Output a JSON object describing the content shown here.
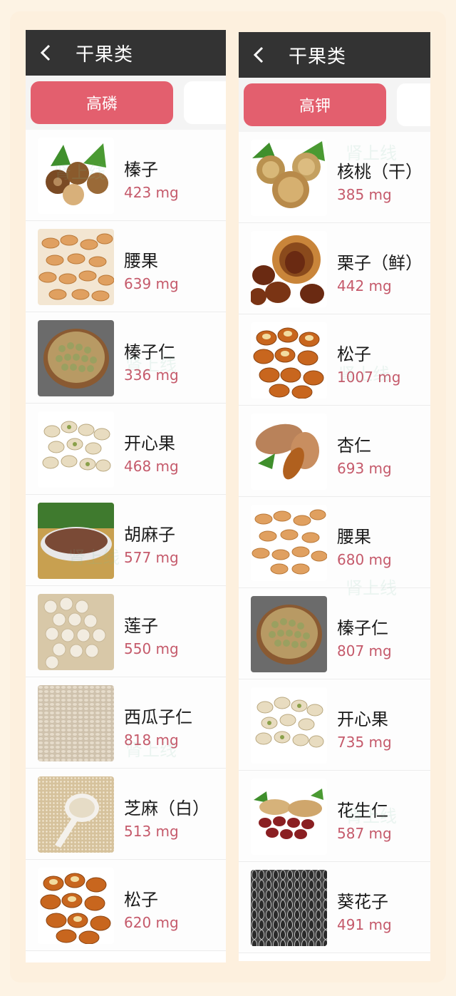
{
  "left": {
    "title": "干果类",
    "tab_active": "高磷",
    "items": [
      {
        "name": "榛子",
        "amount": "423 mg"
      },
      {
        "name": "腰果",
        "amount": "639 mg"
      },
      {
        "name": "榛子仁",
        "amount": "336 mg"
      },
      {
        "name": "开心果",
        "amount": "468 mg"
      },
      {
        "name": "胡麻子",
        "amount": "577 mg"
      },
      {
        "name": "莲子",
        "amount": "550 mg"
      },
      {
        "name": "西瓜子仁",
        "amount": "818 mg"
      },
      {
        "name": "芝麻（白）",
        "amount": "513 mg"
      },
      {
        "name": "松子",
        "amount": "620 mg"
      }
    ]
  },
  "right": {
    "title": "干果类",
    "tab_active": "高钾",
    "items": [
      {
        "name": "核桃（干）",
        "amount": "385 mg"
      },
      {
        "name": "栗子（鲜）",
        "amount": "442 mg"
      },
      {
        "name": "松子",
        "amount": "1007 mg"
      },
      {
        "name": "杏仁",
        "amount": "693 mg"
      },
      {
        "name": "腰果",
        "amount": "680 mg"
      },
      {
        "name": "榛子仁",
        "amount": "807 mg"
      },
      {
        "name": "开心果",
        "amount": "735 mg"
      },
      {
        "name": "花生仁",
        "amount": "587 mg"
      },
      {
        "name": "葵花子",
        "amount": "491 mg"
      }
    ]
  },
  "watermark": "肾上线",
  "colors": {
    "header": "#333333",
    "tab_active": "#e35f6e",
    "amount_text": "#c55a6b",
    "frame": "#fdf0de"
  },
  "icons": {
    "back": "chevron-left-icon"
  }
}
